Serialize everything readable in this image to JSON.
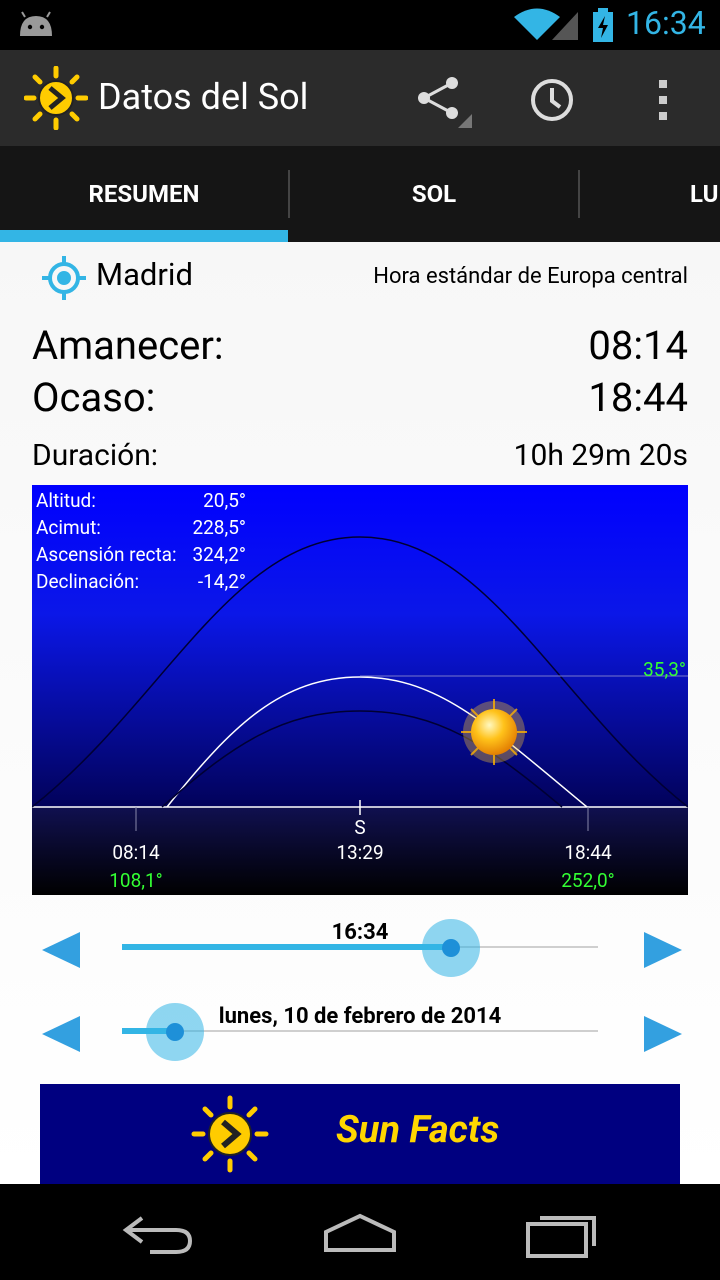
{
  "status_bar": {
    "time": "16:34",
    "icons": [
      "android-icon",
      "wifi-icon",
      "signal-icon",
      "battery-charging-icon"
    ]
  },
  "action_bar": {
    "title": "Datos del Sol",
    "icons": [
      "app-sun-logo-icon",
      "share-icon",
      "clock-icon",
      "overflow-menu-icon"
    ]
  },
  "tabs": [
    {
      "label": "RESUMEN",
      "selected": true
    },
    {
      "label": "SOL"
    },
    {
      "label": "LU"
    }
  ],
  "location": {
    "city": "Madrid",
    "timezone": "Hora estándar de Europa central"
  },
  "times": {
    "sunrise_label": "Amanecer:",
    "sunrise": "08:14",
    "sunset_label": "Ocaso:",
    "sunset": "18:44",
    "duration_label": "Duración:",
    "duration": "10h 29m 20s"
  },
  "chart_info": {
    "altitude_label": "Altitud:",
    "altitude": "20,5°",
    "azimuth_label": "Acimut:",
    "azimuth": "228,5°",
    "ra_label": "Ascensión recta:",
    "ra": "324,2°",
    "dec_label": "Declinación:",
    "dec": "-14,2°",
    "max_alt": "35,3°",
    "south": "S",
    "rise_time": "08:14",
    "noon_time": "13:29",
    "set_time": "18:44",
    "rise_az": "108,1°",
    "set_az": "252,0°"
  },
  "time_slider": {
    "label": "16:34",
    "value_fraction": 0.69
  },
  "date_slider": {
    "label": "lunes, 10 de febrero de 2014",
    "value_fraction": 0.11
  },
  "banner": {
    "text": "Sun Facts"
  },
  "colors": {
    "accent": "#33b5e5",
    "chart_bg": "#0000ff",
    "azimuth_green": "#33ff33",
    "banner_bg": "#000080",
    "banner_text": "#ffd600"
  }
}
